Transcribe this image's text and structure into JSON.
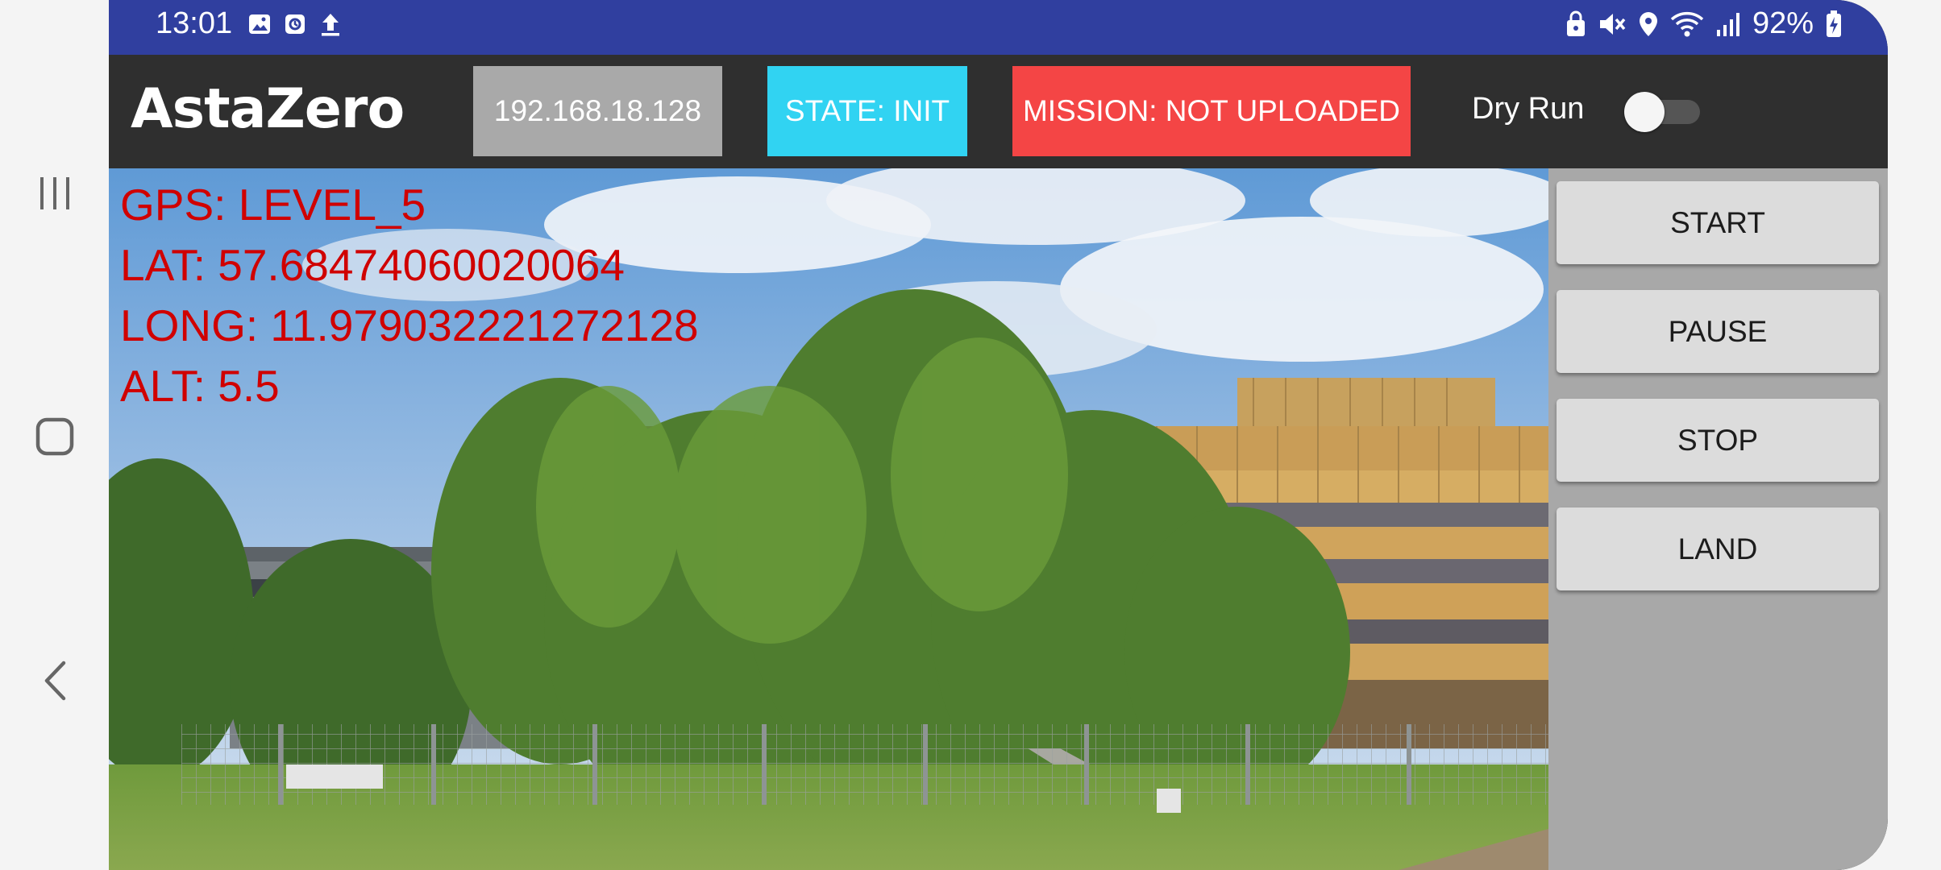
{
  "status_bar": {
    "time": "13:01",
    "left_icons": [
      "image-icon",
      "screenshot-icon",
      "upload-icon"
    ],
    "right_icons": [
      "lock-icon",
      "mute-icon",
      "location-icon",
      "wifi-icon",
      "signal-icon"
    ],
    "battery_pct": "92%"
  },
  "app": {
    "logo": "AstaZero",
    "ip": "192.168.18.128",
    "state": "STATE: INIT",
    "mission": "MISSION: NOT UPLOADED",
    "dry_run_label": "Dry Run",
    "dry_run_on": false,
    "colors": {
      "ip": "#a9a9a9",
      "state": "#31d3f2",
      "mission": "#f44545",
      "appbar": "#2f2f2f",
      "statusbar": "#303f9f",
      "telemetry": "#d00000"
    }
  },
  "telemetry": {
    "gps": "GPS: LEVEL_5",
    "lat": "LAT: 57.68474060020064",
    "long": "LONG: 11.979032221272128",
    "alt": "ALT: 5.5"
  },
  "controls": {
    "start": "START",
    "pause": "PAUSE",
    "stop": "STOP",
    "land": "LAND"
  },
  "nav": [
    "recents-icon",
    "home-icon",
    "back-icon"
  ]
}
